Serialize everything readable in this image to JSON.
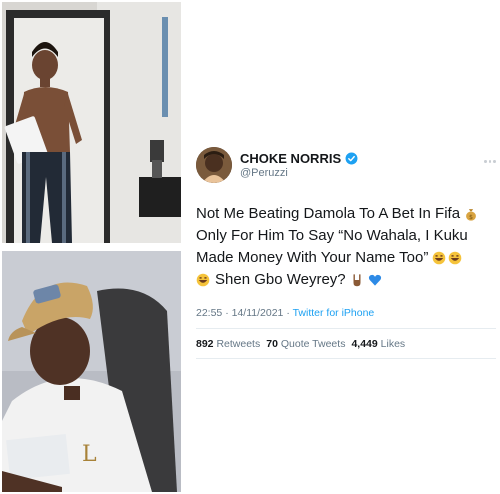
{
  "tweet": {
    "display_name": "CHOKE NORRIS",
    "handle": "@Peruzzi",
    "text_line1": "Not Me Beating Damola To A Bet In Fifa",
    "text_line2": "Only For Him To Say “No Wahala, I Kuku",
    "text_line3": "Made Money With Your Name Too”",
    "text_line4": "Shen Gbo Weyrey?",
    "time": "22:55",
    "date": "14/11/2021",
    "separator": "·",
    "source": "Twitter for iPhone",
    "retweets_count": "892",
    "retweets_label": "Retweets",
    "quotes_count": "70",
    "quotes_label": "Quote Tweets",
    "likes_count": "4,449",
    "likes_label": "Likes"
  },
  "icons": {
    "verified": "verified-badge-icon",
    "money_bag": "money-bag-icon",
    "laughing": "grinning-sweat-icon",
    "rock_hand": "rock-hand-icon",
    "heart": "blue-heart-icon",
    "more": "more-dots-icon"
  },
  "colors": {
    "twitter_blue": "#1da1f2",
    "text": "#14171a",
    "secondary": "#657786"
  }
}
